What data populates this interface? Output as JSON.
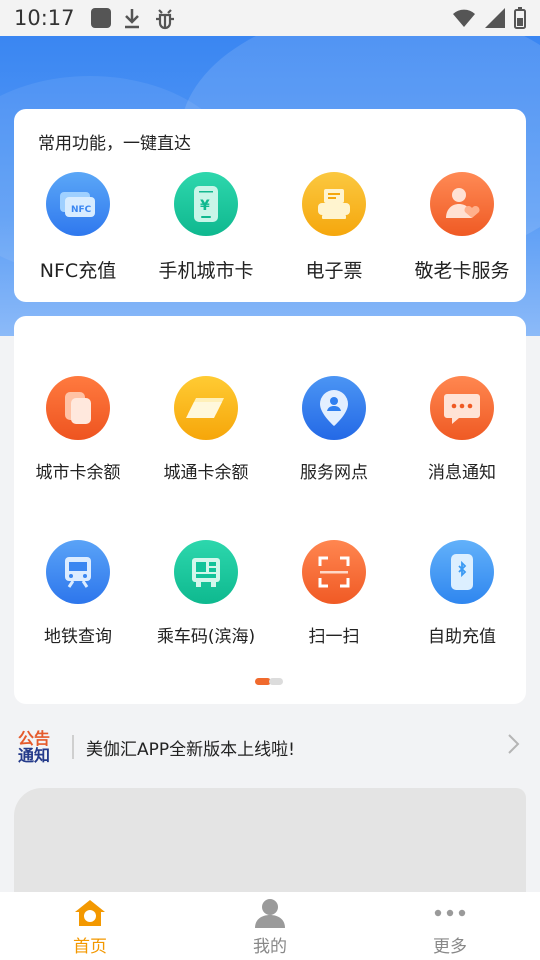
{
  "status_bar": {
    "time": "10:17"
  },
  "quick_section": {
    "title": "常用功能，一键直达",
    "items": [
      {
        "label": "NFC充值",
        "icon": "nfc-card-icon",
        "color": "#3b86f1"
      },
      {
        "label": "手机城市卡",
        "icon": "phone-yuan-icon",
        "color": "#14c29a"
      },
      {
        "label": "电子票",
        "icon": "ticket-printer-icon",
        "color": "#f7b521"
      },
      {
        "label": "敬老卡服务",
        "icon": "elder-person-heart-icon",
        "color": "#f26b2e"
      }
    ]
  },
  "functions": {
    "row1": [
      {
        "label": "城市卡余额",
        "icon": "city-card-balance-icon",
        "color": "#f3622a"
      },
      {
        "label": "城通卡余额",
        "icon": "city-pass-card-icon",
        "color": "#f9b418"
      },
      {
        "label": "服务网点",
        "icon": "location-person-icon",
        "color": "#2f7ff0"
      },
      {
        "label": "消息通知",
        "icon": "message-bubble-icon",
        "color": "#f26b2e"
      }
    ],
    "row2": [
      {
        "label": "地铁查询",
        "icon": "metro-train-icon",
        "color": "#3a86f1"
      },
      {
        "label": "乘车码(滨海)",
        "icon": "bus-code-icon",
        "color": "#13c39a"
      },
      {
        "label": "扫一扫",
        "icon": "scan-frame-icon",
        "color": "#f36b2c"
      },
      {
        "label": "自助充值",
        "icon": "phone-bluetooth-icon",
        "color": "#3b9af3"
      }
    ]
  },
  "notice": {
    "badge_top": "公告",
    "badge_bottom": "通知",
    "text": "美伽汇APP全新版本上线啦!"
  },
  "tabbar": {
    "items": [
      {
        "label": "首页",
        "icon": "home-icon",
        "active": true
      },
      {
        "label": "我的",
        "icon": "user-icon",
        "active": false
      },
      {
        "label": "更多",
        "icon": "more-dots-icon",
        "active": false
      }
    ],
    "active_color": "#f39800"
  }
}
